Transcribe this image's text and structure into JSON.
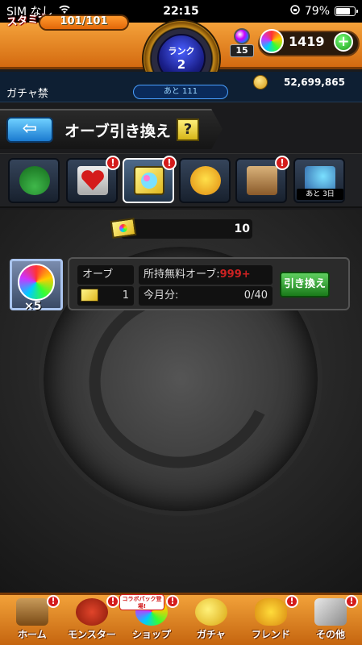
{
  "status_bar": {
    "carrier": "SIM なし",
    "time": "22:15",
    "battery_percent": "79%",
    "battery_level": 0.79
  },
  "hud": {
    "stamina_label": "スタミナ",
    "stamina_value": "101/101",
    "stamina_fill": 1.0,
    "rank_label": "ランク",
    "rank_value": "2",
    "level_badge": "15",
    "orb_count": "1419",
    "plus_label": "+",
    "gacha_ban_label": "ガチャ禁",
    "rank_remaining": "あと 111",
    "coin_count": "52,699,865"
  },
  "title_bar": {
    "back_label": "⇦",
    "title": "オーブ引き換え",
    "help_label": "?"
  },
  "tabs": [
    {
      "name": "clover-hat",
      "exclamation": ""
    },
    {
      "name": "heart-card",
      "exclamation": "!"
    },
    {
      "name": "orb-ticket",
      "exclamation": "!",
      "active": true
    },
    {
      "name": "chick-monster",
      "exclamation": ""
    },
    {
      "name": "castle",
      "exclamation": "!"
    },
    {
      "name": "orb-arrow",
      "exclamation": "",
      "days_left": "あと 3日"
    }
  ],
  "ticket": {
    "count": "10"
  },
  "exchange": {
    "orb_multiplier": "×5",
    "orb_label": "オーブ",
    "owned_label": "所持無料オーブ:",
    "owned_value": "999+",
    "quantity": "1",
    "month_label": "今月分:",
    "month_value": "0/40",
    "exchange_button": "引き換え"
  },
  "bottom_nav": {
    "collab_badge": "コラボパック登場!",
    "items": [
      {
        "label": "ホーム",
        "exclamation": "!"
      },
      {
        "label": "モンスター",
        "exclamation": "!"
      },
      {
        "label": "ショップ",
        "exclamation": "!"
      },
      {
        "label": "ガチャ",
        "exclamation": ""
      },
      {
        "label": "フレンド",
        "exclamation": "!"
      },
      {
        "label": "その他",
        "exclamation": "!"
      }
    ]
  }
}
